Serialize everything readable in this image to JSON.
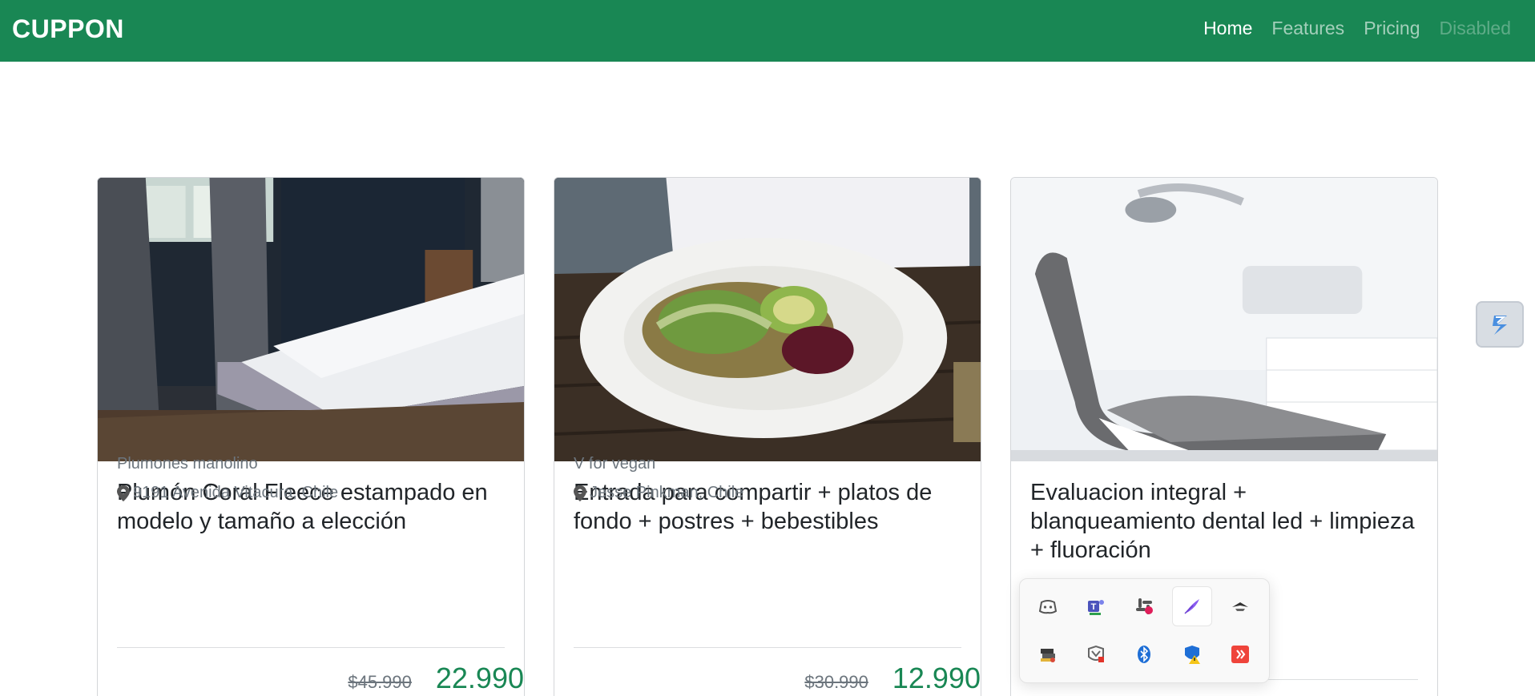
{
  "navbar": {
    "brand": "CUPPON",
    "links": [
      {
        "label": "Home",
        "state": "active"
      },
      {
        "label": "Features",
        "state": "normal"
      },
      {
        "label": "Pricing",
        "state": "normal"
      },
      {
        "label": "Disabled",
        "state": "disabled"
      }
    ]
  },
  "colors": {
    "brand_green": "#198754",
    "muted_text": "#6c757d"
  },
  "cards": [
    {
      "image": "bedroom-bed-photo",
      "title": "Plumón Coral Fleece estampado en modelo y tamaño a elección",
      "vendor": "Plumones manolino",
      "location": "9191 Avenida Vitacura, Chile",
      "old_price": "$45.990",
      "new_price": "22.990"
    },
    {
      "image": "salad-plate-photo",
      "title": "Entrada para compartir + platos de fondo + postres + bebestibles",
      "vendor": "V for vegan",
      "location": "Jesse Pinkman, Chile",
      "old_price": "$30.990",
      "new_price": "12.990"
    },
    {
      "image": "dental-chair-photo",
      "title": "Evaluacion integral + blanqueamiento dental led + limpieza + fluoración"
    }
  ],
  "tray": {
    "icons": [
      "discord-icon",
      "teams-icon",
      "slack-icon",
      "feather-icon",
      "stealth-icon",
      "stack-icon",
      "mcafee-icon",
      "bluetooth-icon",
      "defender-warning-icon",
      "anydesk-icon"
    ]
  },
  "extension_button": "snipping-extension-icon"
}
